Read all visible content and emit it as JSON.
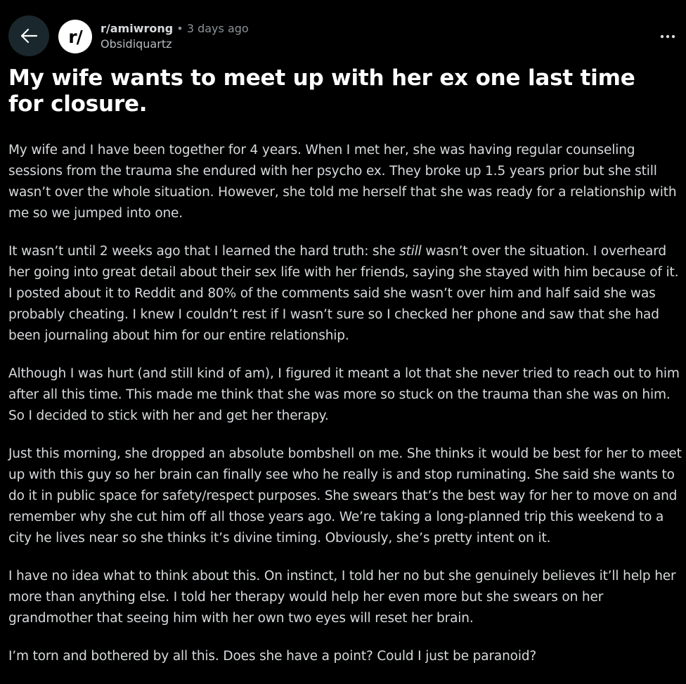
{
  "header": {
    "back_icon": "arrow-left-icon",
    "subreddit_icon_text": "r/",
    "subreddit": "r/amiwrong",
    "separator": "•",
    "time_ago": "3 days ago",
    "author": "Obsidiquartz",
    "more_icon": "more-horizontal-icon"
  },
  "post": {
    "title": "My wife wants to meet up with her ex one last time for closure.",
    "paragraphs": [
      "My wife and I have been together for 4 years. When I met her, she was having regular counseling sessions from the trauma she endured with her psycho ex. They broke up 1.5 years prior but she still wasn’t over the whole situation. However, she told me herself that she was ready for a relationship with me so we jumped into one.",
      {
        "before": "It wasn’t until 2 weeks ago that I learned the hard truth: she ",
        "emphasis": "still",
        "after": " wasn’t over the situation. I overheard her going into great detail about their sex life with her friends, saying she stayed with him because of it. I posted about it to Reddit and 80% of the comments said she wasn’t over him and half said she was probably cheating. I knew I couldn’t rest if I wasn’t sure so I checked her phone and saw that she had been journaling about him for our entire relationship."
      },
      "Although I was hurt (and still kind of am), I figured it meant a lot that she never tried to reach out to him after all this time. This made me think that she was more so stuck on the trauma than she was on him. So I decided to stick with her and get her therapy.",
      "Just this morning, she dropped an absolute bombshell on me. She thinks it would be best for her to meet up with this guy so her brain can finally see who he really is and stop ruminating. She said she wants to do it in public space for safety/respect purposes. She swears that’s the best way for her to move on and remember why she cut him off all those years ago. We’re taking a long-planned trip this weekend to a city he lives near so she thinks it’s divine timing. Obviously, she’s pretty intent on it.",
      "I have no idea what to think about this. On instinct, I told her no but she genuinely believes it’ll help her more than anything else. I told her therapy would help her even more but she swears on her grandmother that seeing him with her own two eyes will reset her brain.",
      "I’m torn and bothered by all this. Does she have a point? Could I just be paranoid?"
    ]
  },
  "colors": {
    "background": "#000000",
    "text": "#d7dadc",
    "title": "#ffffff",
    "muted": "#8b9398",
    "back_button_bg": "#1a282d"
  }
}
